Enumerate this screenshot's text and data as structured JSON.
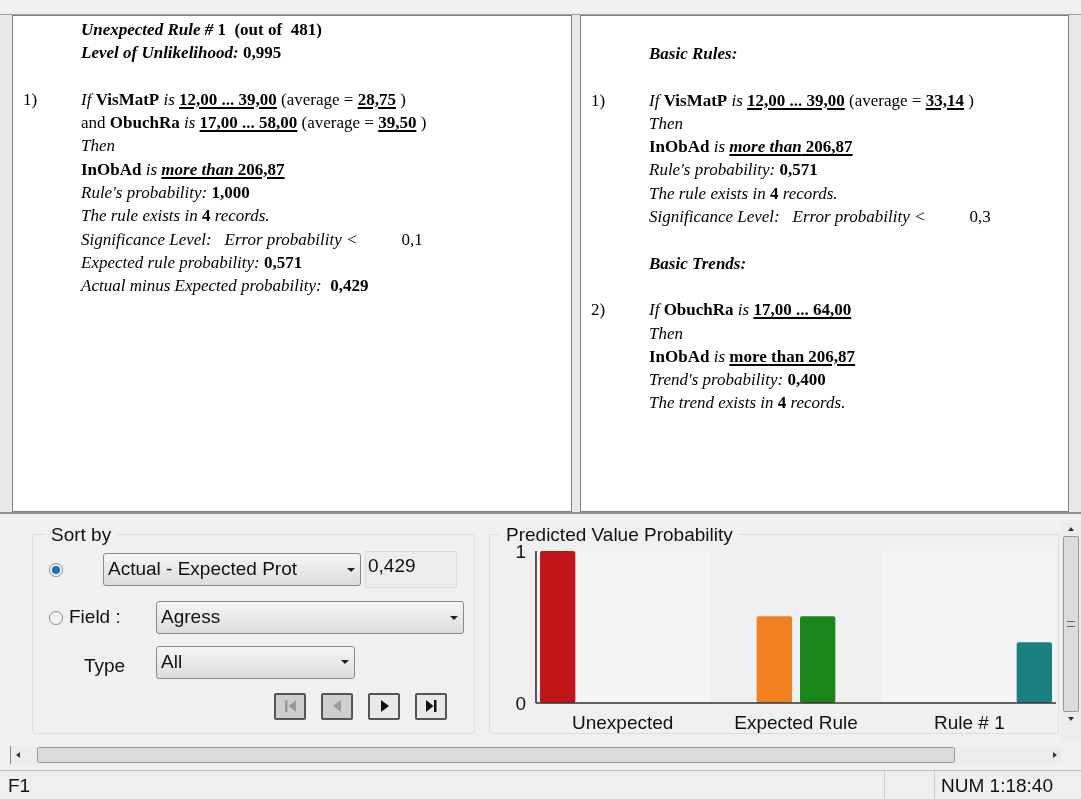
{
  "panels": [
    {
      "blocks": [
        {
          "lines": [
            [
              {
                "t": "*Unexpected Rule #* 1  (out of  481)",
                "bold": true,
                "underline": false
              }
            ],
            [
              {
                "t": "*Level of Unlikelihood:* 0,995",
                "bold": true,
                "underline": false
              }
            ]
          ]
        },
        {
          "number": "1)",
          "lines": [
            [
              {
                "t": "*If* **VisMatP** *is* ",
                "bold": false,
                "underline": false
              },
              {
                "t": "12,00 ... 39,00",
                "bold": true,
                "underline": true
              },
              {
                "t": " (average = ",
                "bold": false,
                "underline": false
              },
              {
                "t": "28,75",
                "bold": true,
                "underline": true
              },
              {
                "t": " )",
                "bold": false,
                "underline": false
              }
            ],
            [
              {
                "t": "and **ObuchRa** *is* ",
                "bold": false,
                "underline": false
              },
              {
                "t": "17,00 ... 58,00",
                "bold": true,
                "underline": true
              },
              {
                "t": " (average = ",
                "bold": false,
                "underline": false
              },
              {
                "t": "39,50",
                "bold": true,
                "underline": true
              },
              {
                "t": " )",
                "bold": false,
                "underline": false
              }
            ],
            [
              {
                "t": "Then",
                "bold": false,
                "italic": true,
                "underline": false
              }
            ],
            [
              {
                "t": "**InObAd** *is* ",
                "bold": false,
                "underline": false
              },
              {
                "t": "*more than* 206,87",
                "bold": true,
                "underline": true
              }
            ],
            [
              {
                "t": "*Rule's probability:* **1,000**",
                "bold": false,
                "underline": false
              }
            ],
            [
              {
                "t": "*The rule exists in* **4** *records.*",
                "bold": false,
                "underline": false
              }
            ],
            [
              {
                "t": "Significance Level:   Error probability <",
                "bold": false,
                "italic": true,
                "underline": false
              },
              {
                "t": "0,1",
                "bold": false,
                "underline": false,
                "tab": true
              }
            ],
            [
              {
                "t": "*Expected rule probability:* **0,571**",
                "bold": false,
                "underline": false
              }
            ],
            [
              {
                "t": "*Actual minus Expected probability:*  **0,429**",
                "bold": false,
                "underline": false
              }
            ]
          ]
        }
      ]
    },
    {
      "blocks": [
        {
          "lines": [
            [
              {
                "t": "Basic Rules:",
                "bold": true,
                "italic": true,
                "underline": false
              }
            ]
          ]
        },
        {
          "number": "1)",
          "lines": [
            [
              {
                "t": "*If* **VisMatP** *is* ",
                "bold": false,
                "underline": false
              },
              {
                "t": "12,00 ... 39,00",
                "bold": true,
                "underline": true
              },
              {
                "t": " (average = ",
                "bold": false,
                "underline": false
              },
              {
                "t": "33,14",
                "bold": true,
                "underline": true
              },
              {
                "t": " )",
                "bold": false,
                "underline": false
              }
            ],
            [
              {
                "t": "Then",
                "bold": false,
                "italic": true,
                "underline": false
              }
            ],
            [
              {
                "t": "**InObAd** *is* ",
                "bold": false,
                "underline": false
              },
              {
                "t": "*more than* 206,87",
                "bold": true,
                "underline": true
              }
            ],
            [
              {
                "t": "*Rule's probability:* **0,571**",
                "bold": false,
                "underline": false
              }
            ],
            [
              {
                "t": "*The rule exists in* **4** *records.*",
                "bold": false,
                "underline": false
              }
            ],
            [
              {
                "t": "Significance Level:   Error probability <",
                "bold": false,
                "italic": true,
                "underline": false
              },
              {
                "t": "0,3",
                "bold": false,
                "underline": false,
                "tab": true
              }
            ]
          ]
        },
        {
          "lines": [
            [
              {
                "t": "Basic Trends:",
                "bold": true,
                "italic": true,
                "underline": false
              }
            ]
          ]
        },
        {
          "number": "2)",
          "lines": [
            [
              {
                "t": "*If* **ObuchRa** *is* ",
                "bold": false,
                "underline": false
              },
              {
                "t": "17,00 ... 64,00",
                "bold": true,
                "underline": true
              }
            ],
            [
              {
                "t": "Then",
                "bold": false,
                "italic": true,
                "underline": false
              }
            ],
            [
              {
                "t": "**InObAd** *is* ",
                "bold": false,
                "underline": false
              },
              {
                "t": "more than 206,87",
                "bold": true,
                "underline": true
              }
            ],
            [
              {
                "t": "*Trend's probability:* **0,400**",
                "bold": false,
                "underline": false
              }
            ],
            [
              {
                "t": "*The trend exists in* **4** *records.*",
                "bold": false,
                "underline": false
              }
            ]
          ]
        }
      ]
    }
  ],
  "sort": {
    "title": "Sort by",
    "options": [
      {
        "kind": "dropdown",
        "selected": true,
        "value": "Actual - Expected Prot",
        "reading": "0,429"
      },
      {
        "kind": "field",
        "selected": false,
        "label": "Field :",
        "value": "Agress"
      }
    ],
    "type_label": "Type",
    "type_value": "All",
    "nav": [
      {
        "kind": "first",
        "disabled": true
      },
      {
        "kind": "prev",
        "disabled": true
      },
      {
        "kind": "next",
        "disabled": false
      },
      {
        "kind": "last",
        "disabled": false
      }
    ]
  },
  "chart": {
    "title": "Predicted Value Probability",
    "chart_data": {
      "type": "bar",
      "categories": [
        "Unexpected",
        "Expected Rule",
        "Rule # 1"
      ],
      "ylim": [
        0,
        1
      ],
      "yticks": [
        0,
        1
      ],
      "series": [
        {
          "color": "#c0161a",
          "values": [
            1,
            null,
            null
          ]
        },
        {
          "color": "#f08020",
          "values": [
            null,
            0.571,
            null
          ]
        },
        {
          "color": "#1a861a",
          "values": [
            null,
            0.571,
            null
          ]
        },
        {
          "color": "#1a8080",
          "values": [
            null,
            null,
            0.4
          ]
        }
      ]
    }
  },
  "status_bar": {
    "left": "F1",
    "right": "NUM 1:18:40"
  }
}
